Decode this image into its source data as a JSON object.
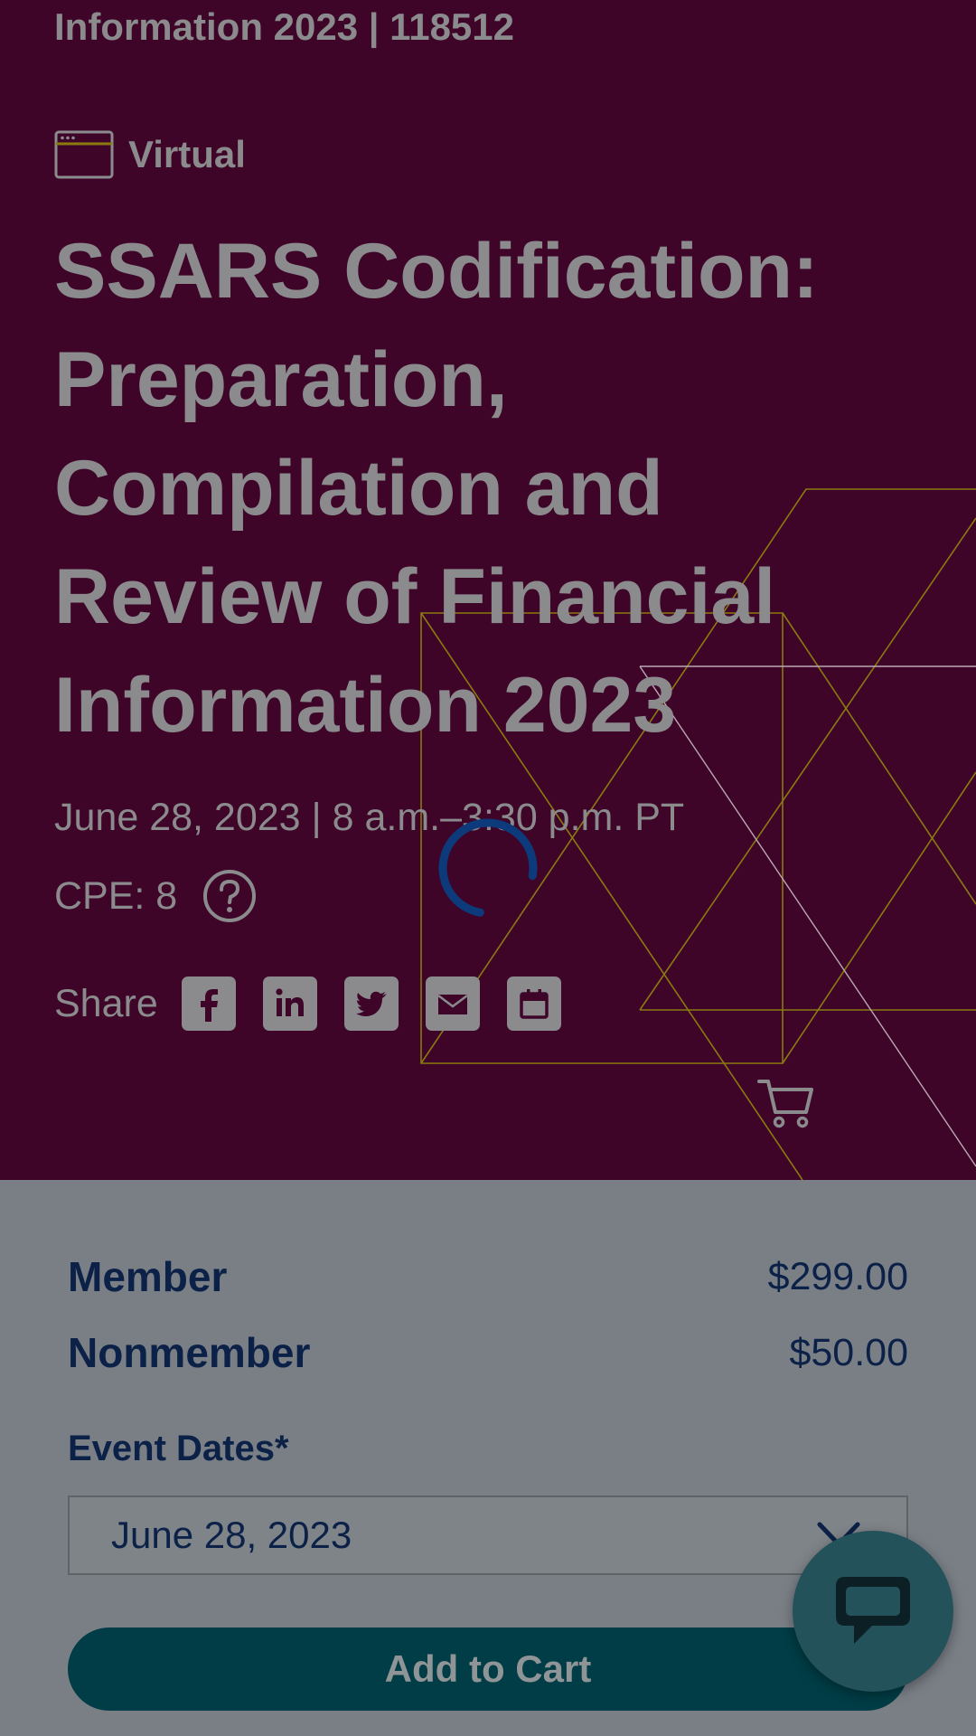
{
  "hero": {
    "header_title": "Information 2023 | 118512",
    "format_label": "Virtual",
    "event_title": "SSARS Codification: Preparation, Compilation and Review of Financial Information 2023",
    "event_date": "June 28, 2023 | 8 a.m.–3:30 p.m. PT",
    "cpe": "CPE: 8",
    "share_label": "Share",
    "share_icons": [
      "facebook-icon",
      "linkedin-icon",
      "twitter-icon",
      "email-icon",
      "calendar-icon"
    ]
  },
  "pricing": {
    "member_label": "Member",
    "member_price": "$299.00",
    "nonmember_label": "Nonmember",
    "nonmember_price": "$50.00"
  },
  "event_dates": {
    "label": "Event Dates*",
    "selected": "June 28, 2023"
  },
  "actions": {
    "add_to_cart": "Add to Cart"
  },
  "colors": {
    "hero_background": "#3e0529",
    "overlay_text": "#8b8b8d",
    "accent_line": "#8a7a10",
    "navy_text": "#0b2147",
    "button_teal": "#013d46",
    "spinner": "#0c3a7a"
  }
}
